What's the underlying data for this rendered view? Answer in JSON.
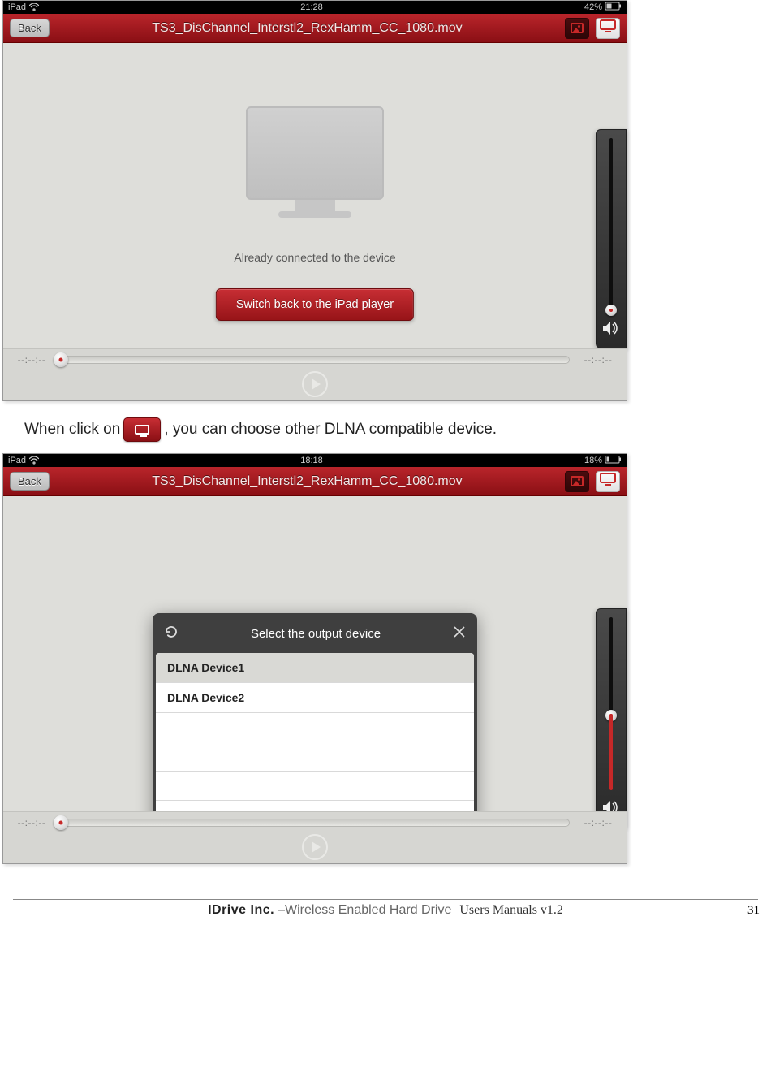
{
  "screenshot1": {
    "statusbar": {
      "device": "iPad",
      "time": "21:28",
      "battery": "42%"
    },
    "titlebar": {
      "back": "Back",
      "title": "TS3_DisChannel_Interstl2_RexHamm_CC_1080.mov"
    },
    "connected_text": "Already connected to the device",
    "switch_button": "Switch back to the iPad player",
    "timeline": {
      "left": "--:--:--",
      "right": "--:--:--"
    }
  },
  "instruction": {
    "pre": "When click on ",
    "post": ", you can choose other DLNA compatible device."
  },
  "screenshot2": {
    "statusbar": {
      "device": "iPad",
      "time": "18:18",
      "battery": "18%"
    },
    "titlebar": {
      "back": "Back",
      "title": "TS3_DisChannel_Interstl2_RexHamm_CC_1080.mov"
    },
    "popup": {
      "title": "Select the output device",
      "items": [
        "DLNA Device1",
        "DLNA Device2"
      ]
    },
    "timeline": {
      "left": "--:--:--",
      "right": "--:--:--"
    }
  },
  "footer": {
    "company": "IDrive Inc.",
    "subtitle": "–Wireless Enabled Hard Drive",
    "manual": "Users Manuals v1.2",
    "page": "31"
  }
}
